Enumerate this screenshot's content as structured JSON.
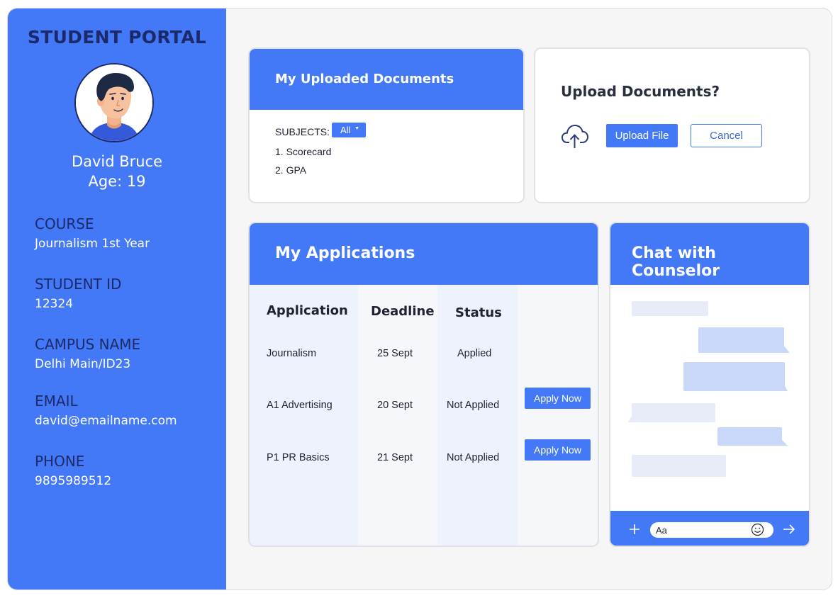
{
  "sidebar": {
    "title": "STUDENT PORTAL",
    "name": "David Bruce",
    "age": "Age: 19",
    "fields": [
      {
        "label": "COURSE",
        "value": "Journalism 1st Year"
      },
      {
        "label": "STUDENT ID",
        "value": "12324"
      },
      {
        "label": "CAMPUS NAME",
        "value": "Delhi Main/ID23"
      },
      {
        "label": "EMAIL",
        "value": "david@emailname.com"
      },
      {
        "label": "PHONE",
        "value": "9895989512"
      }
    ]
  },
  "documents": {
    "title": "My Uploaded Documents",
    "subjects_label": "SUBJECTS:",
    "filter_value": "All",
    "items": [
      "1. Scorecard",
      "2. GPA"
    ]
  },
  "upload": {
    "title": "Upload Documents?",
    "upload_label": "Upload File",
    "cancel_label": "Cancel"
  },
  "applications": {
    "title": "My Applications",
    "columns": [
      "Application",
      "Deadline",
      "Status"
    ],
    "rows": [
      {
        "application": "Journalism",
        "deadline": "25 Sept",
        "status": "Applied",
        "action": ""
      },
      {
        "application": "A1 Advertising",
        "deadline": "20 Sept",
        "status": "Not Applied",
        "action": "Apply Now"
      },
      {
        "application": "P1 PR Basics",
        "deadline": "21 Sept",
        "status": "Not Applied",
        "action": "Apply Now"
      }
    ]
  },
  "chat": {
    "title": "Chat with Counselor",
    "input_value": "Aa"
  },
  "colors": {
    "accent": "#4379f7",
    "navy": "#1c2a6b"
  },
  "icons": [
    "avatar-illustration",
    "cloud-upload-icon",
    "dropdown-caret-icon",
    "plus-icon",
    "emoji-icon",
    "send-arrow-icon"
  ]
}
